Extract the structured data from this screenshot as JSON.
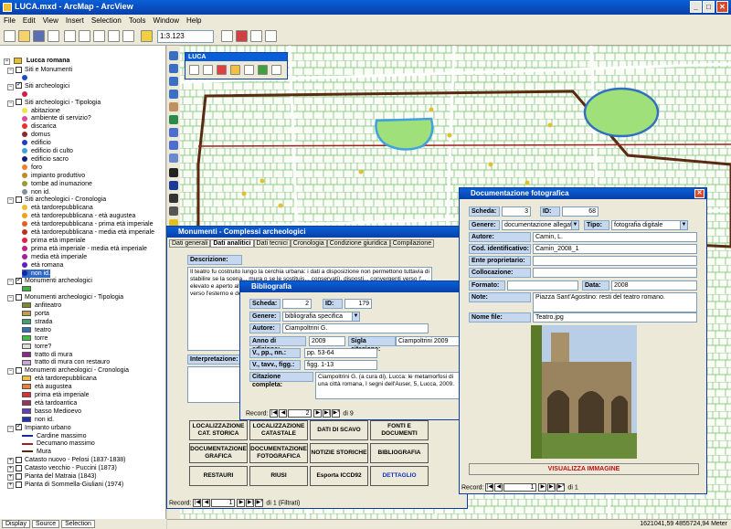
{
  "app": {
    "title": "LUCA.mxd - ArcMap - ArcView",
    "menu": [
      "File",
      "Edit",
      "View",
      "Insert",
      "Selection",
      "Tools",
      "Window",
      "Help"
    ],
    "scale": "1:3.123"
  },
  "toc": {
    "root": "Lucca romana",
    "tabs": [
      "Display",
      "Source",
      "Selection"
    ],
    "rows": [
      {
        "label": "Siti e Monumenti",
        "kind": "group",
        "indent": 1,
        "checked": false
      },
      {
        "label": "",
        "kind": "dot",
        "indent": 3,
        "color": "#1e4fc2"
      },
      {
        "label": "Siti archeologici",
        "kind": "group",
        "indent": 1,
        "checked": true
      },
      {
        "label": "",
        "kind": "dot",
        "indent": 3,
        "color": "#cc2244"
      },
      {
        "label": "Siti archeologici - Tipologia",
        "kind": "group",
        "indent": 1,
        "checked": false
      },
      {
        "label": "abitazione",
        "kind": "dot",
        "indent": 3,
        "color": "#f3e34a"
      },
      {
        "label": "ambiente di servizio?",
        "kind": "dot",
        "indent": 3,
        "color": "#d94a9a"
      },
      {
        "label": "discarica",
        "kind": "dot",
        "indent": 3,
        "color": "#e83030"
      },
      {
        "label": "domus",
        "kind": "dot",
        "indent": 3,
        "color": "#8a2a2a"
      },
      {
        "label": "edificio",
        "kind": "dot",
        "indent": 3,
        "color": "#2040c0"
      },
      {
        "label": "edificio di culto",
        "kind": "dot",
        "indent": 3,
        "color": "#40a0e0"
      },
      {
        "label": "edificio sacro",
        "kind": "dot",
        "indent": 3,
        "color": "#102080"
      },
      {
        "label": "foro",
        "kind": "dot",
        "indent": 3,
        "color": "#f08030"
      },
      {
        "label": "impianto produttivo",
        "kind": "dot",
        "indent": 3,
        "color": "#c08a30"
      },
      {
        "label": "tombe ad inumazione",
        "kind": "dot",
        "indent": 3,
        "color": "#9a9a30"
      },
      {
        "label": "non id.",
        "kind": "dot",
        "indent": 3,
        "color": "#8090a0"
      },
      {
        "label": "Siti archeologici - Cronologia",
        "kind": "group",
        "indent": 1,
        "checked": false
      },
      {
        "label": "età tardorepubblicana",
        "kind": "dot",
        "indent": 3,
        "color": "#e8c030"
      },
      {
        "label": "età tardorepubblicana - età augustea",
        "kind": "dot",
        "indent": 3,
        "color": "#f0a020"
      },
      {
        "label": "età tardorepubblicana - prima età imperiale",
        "kind": "dot",
        "indent": 3,
        "color": "#e06020"
      },
      {
        "label": "età tardorepubblicana - media età imperiale",
        "kind": "dot",
        "indent": 3,
        "color": "#c03020"
      },
      {
        "label": "prima età imperiale",
        "kind": "dot",
        "indent": 3,
        "color": "#e02040"
      },
      {
        "label": "prima età imperiale - media età imperiale",
        "kind": "dot",
        "indent": 3,
        "color": "#c02080"
      },
      {
        "label": "media età imperiale",
        "kind": "dot",
        "indent": 3,
        "color": "#a020a0"
      },
      {
        "label": "età romana",
        "kind": "dot",
        "indent": 3,
        "color": "#6020c0"
      },
      {
        "label": "non id.",
        "kind": "dot",
        "indent": 3,
        "color": "#2020a0",
        "selected": true
      },
      {
        "label": "Monumenti archeologici",
        "kind": "group",
        "indent": 1,
        "checked": true
      },
      {
        "label": "",
        "kind": "rect",
        "indent": 3,
        "color": "#3cb43c"
      },
      {
        "label": "Monumenti archeologici - Tipologia",
        "kind": "group",
        "indent": 1,
        "checked": false
      },
      {
        "label": "anfiteatro",
        "kind": "rect",
        "indent": 3,
        "color": "#7a8a30"
      },
      {
        "label": "porta",
        "kind": "rect",
        "indent": 3,
        "color": "#c0a040"
      },
      {
        "label": "strada",
        "kind": "rect",
        "indent": 3,
        "color": "#40a070"
      },
      {
        "label": "teatro",
        "kind": "rect",
        "indent": 3,
        "color": "#3070c0"
      },
      {
        "label": "torre",
        "kind": "rect",
        "indent": 3,
        "color": "#40c040"
      },
      {
        "label": "torre?",
        "kind": "rect",
        "indent": 3,
        "color": "#e0e0e0"
      },
      {
        "label": "tratto di mura",
        "kind": "rect",
        "indent": 3,
        "color": "#8a2a80"
      },
      {
        "label": "tratto di mura con restauro",
        "kind": "rect",
        "indent": 3,
        "color": "#c8a8d8"
      },
      {
        "label": "Monumenti archeologici - Cronologia",
        "kind": "group",
        "indent": 1,
        "checked": false
      },
      {
        "label": "età tardorepubblicana",
        "kind": "rect",
        "indent": 3,
        "color": "#f0c040"
      },
      {
        "label": "età augustea",
        "kind": "rect",
        "indent": 3,
        "color": "#f08030"
      },
      {
        "label": "prima età imperiale",
        "kind": "rect",
        "indent": 3,
        "color": "#e03030"
      },
      {
        "label": "età tardoantica",
        "kind": "rect",
        "indent": 3,
        "color": "#a03060"
      },
      {
        "label": "basso Medioevo",
        "kind": "rect",
        "indent": 3,
        "color": "#6040c0"
      },
      {
        "label": "non id.",
        "kind": "rect",
        "indent": 3,
        "color": "#2030c0"
      },
      {
        "label": "Impianto urbano",
        "kind": "group",
        "indent": 1,
        "checked": true
      },
      {
        "label": "Cardine massimo",
        "kind": "line",
        "indent": 3,
        "color": "#1030a0"
      },
      {
        "label": "Decumano massimo",
        "kind": "line",
        "indent": 3,
        "color": "#a02020"
      },
      {
        "label": "Mura",
        "kind": "line",
        "indent": 3,
        "color": "#5a2a10"
      },
      {
        "label": "Catasto nuovo - Pelosi (1837-1838)",
        "kind": "group",
        "indent": 1,
        "checked": false,
        "plus": true
      },
      {
        "label": "Catasto vecchio - Puccini (1873)",
        "kind": "group",
        "indent": 1,
        "checked": false,
        "plus": true
      },
      {
        "label": "Pianta del Matraia (1843)",
        "kind": "group",
        "indent": 1,
        "checked": false,
        "plus": true
      },
      {
        "label": "Pianta di Sommella-Giuliani (1974)",
        "kind": "group",
        "indent": 1,
        "checked": false,
        "plus": true
      }
    ]
  },
  "luca_toolbar": {
    "title": "LUCA"
  },
  "monumenti": {
    "title": "Monumenti - Complessi archeologici",
    "tabs": [
      "Dati generali",
      "Dati analitici",
      "Dati tecnici",
      "Cronologia",
      "Condizione giuridica",
      "Compilazione"
    ],
    "descrizione_label": "Descrizione:",
    "descrizione": "Il teatro fu costruito lungo la cerchia urbana: i dati a disposizione non permettono tuttavia di stabilire se la scena... mura o se le sostituis... conservati), disposti... convergenti verso l'... elevato e aperto all'... servizio, quello supe... serviva invece da sc... sedevano gli spettat... verso l'esterno e de... complesso su cui è f... La cavea doveva av...",
    "interpretazione_label": "Interpretazione:",
    "buttons": [
      "LOCALIZZAZIONE CAT. STORICA",
      "LOCALIZZAZIONE CATASTALE",
      "DATI DI SCAVO",
      "FONTI E DOCUMENTI",
      "DOCUMENTAZIONE GRAFICA",
      "DOCUMENTAZIONE FOTOGRAFICA",
      "NOTIZIE STORICHE",
      "BIBLIOGRAFIA",
      "RESTAURI",
      "RIUSI",
      "Esporta ICCD92",
      "DETTAGLIO"
    ],
    "record_label": "Record:",
    "record_value": "1",
    "record_of": "di 1 (Filtrati)"
  },
  "bibliografia": {
    "title": "Bibliografia",
    "scheda_label": "Scheda:",
    "scheda": "2",
    "id_label": "ID:",
    "id": "179",
    "genere_label": "Genere:",
    "genere": "bibliografia specifica",
    "autore_label": "Autore:",
    "autore": "Ciampoltrini G.",
    "anno_label": "Anno di edizione:",
    "anno": "2009",
    "sigla_label": "Sigla citazione:",
    "sigla": "Ciampoltrini 2009",
    "pp_label": "V., pp., nn.:",
    "pp": "pp. 53-64",
    "tav_label": "V., tavv., figg.:",
    "tav": "figg. 1-13",
    "citazione_label": "Citazione completa:",
    "citazione": "Ciampoltrini G. (a cura di), Lucca: le metamorfosi di una città romana, I segni dell'Auser, 5, Lucca, 2009.",
    "record_label": "Record:",
    "record_value": "2",
    "record_of": "di 9"
  },
  "fotografica": {
    "title": "Documentazione fotografica",
    "scheda_label": "Scheda:",
    "scheda": "3",
    "id_label": "ID:",
    "id": "68",
    "genere_label": "Genere:",
    "genere": "documentazione allegata",
    "tipo_label": "Tipo:",
    "tipo": "fotografia digitale",
    "autore_label": "Autore:",
    "autore": "Camin, L.",
    "cod_label": "Cod. identificativo:",
    "cod": "Camin_2008_1",
    "ente_label": "Ente proprietario:",
    "ente": "",
    "coll_label": "Collocazione:",
    "coll": "",
    "formato_label": "Formato:",
    "formato": "",
    "data_label": "Data:",
    "data": "2008",
    "note_label": "Note:",
    "note": "Piazza Sant'Agostino: resti del teatro romano.",
    "nome_label": "Nome file:",
    "nome": "Teatro.jpg",
    "visualizza": "VISUALIZZA IMMAGINE",
    "record_label": "Record:",
    "record_value": "1",
    "record_of": "di 1"
  },
  "status": {
    "coords": "1621041,59  4855724,94 Meter"
  }
}
